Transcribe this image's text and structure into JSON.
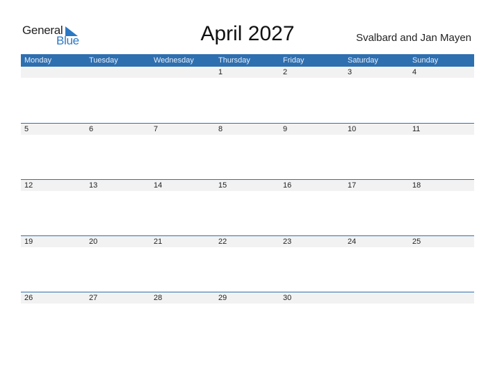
{
  "logo": {
    "line1": "General",
    "line2": "Blue"
  },
  "title": "April 2027",
  "region": "Svalbard and Jan Mayen",
  "colors": {
    "accent": "#2e6fb0",
    "date_strip": "#f2f2f2",
    "logo_blue": "#2a78c4"
  },
  "weekdays": [
    "Monday",
    "Tuesday",
    "Wednesday",
    "Thursday",
    "Friday",
    "Saturday",
    "Sunday"
  ],
  "weeks": [
    [
      "",
      "",
      "",
      "1",
      "2",
      "3",
      "4"
    ],
    [
      "5",
      "6",
      "7",
      "8",
      "9",
      "10",
      "11"
    ],
    [
      "12",
      "13",
      "14",
      "15",
      "16",
      "17",
      "18"
    ],
    [
      "19",
      "20",
      "21",
      "22",
      "23",
      "24",
      "25"
    ],
    [
      "26",
      "27",
      "28",
      "29",
      "30",
      "",
      ""
    ]
  ]
}
